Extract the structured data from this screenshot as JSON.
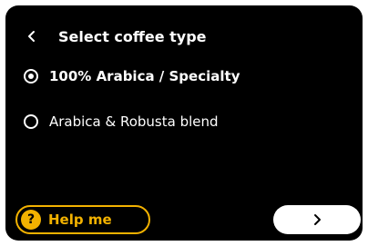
{
  "header": {
    "title": "Select coffee type",
    "back_icon": "chevron-left-icon"
  },
  "options": [
    {
      "label": "100% Arabica / Specialty",
      "selected": true
    },
    {
      "label": "Arabica & Robusta blend",
      "selected": false
    }
  ],
  "footer": {
    "help_label": "Help me",
    "help_icon": "question-mark-icon",
    "help_icon_glyph": "?",
    "next_icon": "chevron-right-icon"
  },
  "colors": {
    "background": "#000000",
    "accent": "#f3b200",
    "text": "#ffffff"
  }
}
